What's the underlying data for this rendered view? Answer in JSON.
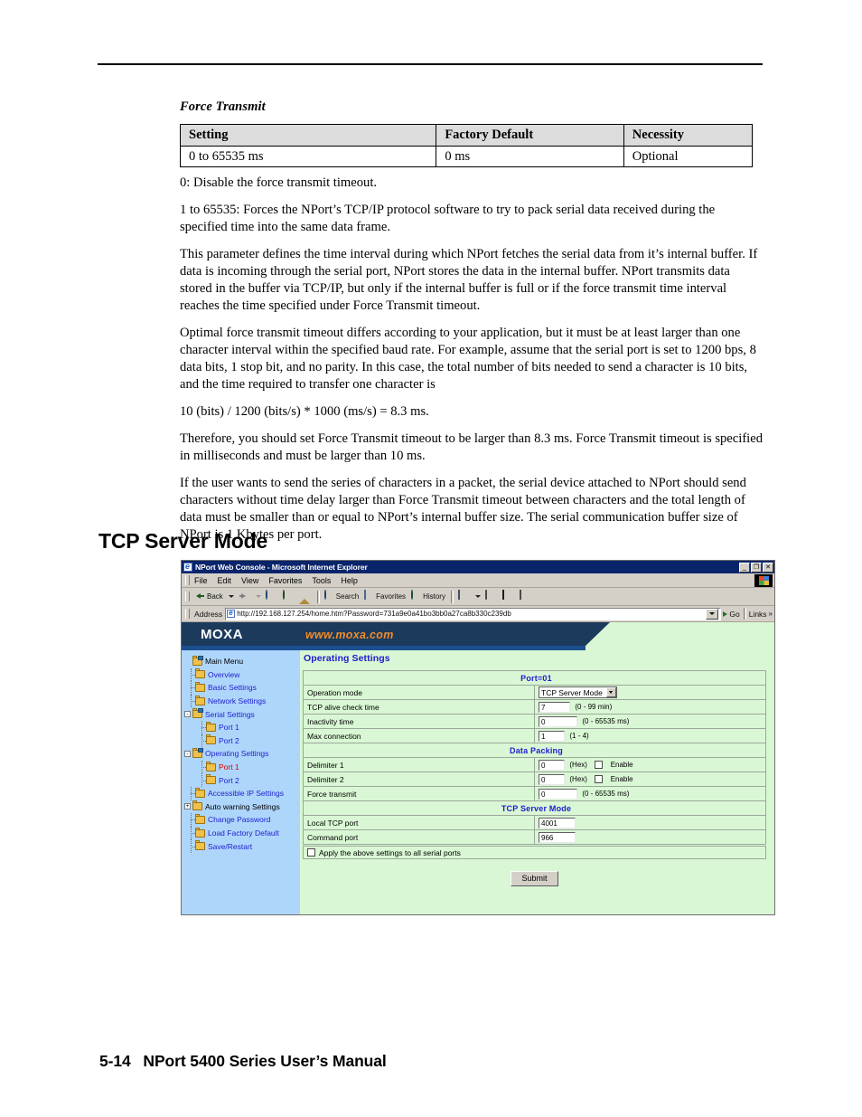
{
  "document": {
    "subhead": "Force Transmit",
    "table": {
      "headers": [
        "Setting",
        "Factory Default",
        "Necessity"
      ],
      "rows": [
        [
          "0 to 65535 ms",
          "0 ms",
          "Optional"
        ]
      ]
    },
    "paragraphs": [
      "0: Disable the force transmit timeout.",
      "1 to 65535: Forces the NPort’s TCP/IP protocol software to try to pack serial data received during the specified time into the same data frame.",
      "This parameter defines the time interval during which NPort fetches the serial data from it’s internal buffer. If data is incoming through the serial port, NPort stores the data in the internal buffer. NPort transmits data stored in the buffer via TCP/IP, but only if the internal buffer is full or if the force transmit time interval reaches the time specified under Force Transmit timeout.",
      "Optimal force transmit timeout differs according to your application, but it must be at least larger than one character interval within the specified baud rate. For example, assume that the serial port is set to 1200 bps, 8 data bits, 1 stop bit, and no parity. In this case, the total number of bits needed to send a character is 10 bits, and the time required to transfer one character is",
      "10 (bits) / 1200 (bits/s) * 1000 (ms/s) = 8.3 ms.",
      "Therefore, you should set Force Transmit timeout to be larger than 8.3 ms. Force Transmit timeout is specified in milliseconds and must be larger than 10 ms.",
      "If the user wants to send the series of characters in a packet, the serial device attached to NPort should send characters without time delay larger than Force Transmit timeout between characters and the total length of data must be smaller than or equal to NPort’s internal buffer size. The serial communication buffer size of NPort is 1 Kbytes per port."
    ],
    "section_heading": "TCP Server Mode",
    "footer": {
      "page_number": "5-14",
      "manual_title": "NPort 5400 Series User’s Manual"
    }
  },
  "browser": {
    "window_title": "NPort Web Console - Microsoft Internet Explorer",
    "window_buttons": {
      "minimize": "_",
      "restore": "❐",
      "close": "✕"
    },
    "menu": [
      "File",
      "Edit",
      "View",
      "Favorites",
      "Tools",
      "Help"
    ],
    "toolbar": [
      {
        "label": "Back",
        "icon": "back-arrow-icon",
        "dropdown": true
      },
      {
        "label": "",
        "icon": "forward-arrow-icon",
        "dropdown": true
      },
      {
        "label": "",
        "icon": "stop-icon",
        "dropdown": false
      },
      {
        "label": "",
        "icon": "refresh-icon",
        "dropdown": false
      },
      {
        "label": "",
        "icon": "home-icon",
        "dropdown": false
      },
      {
        "label": "Search",
        "icon": "search-icon",
        "dropdown": false
      },
      {
        "label": "Favorites",
        "icon": "favorites-icon",
        "dropdown": false
      },
      {
        "label": "History",
        "icon": "history-icon",
        "dropdown": false
      },
      {
        "label": "",
        "icon": "mail-icon",
        "dropdown": true
      },
      {
        "label": "",
        "icon": "print-icon",
        "dropdown": false
      },
      {
        "label": "",
        "icon": "edit-icon",
        "dropdown": false
      },
      {
        "label": "",
        "icon": "discuss-icon",
        "dropdown": false
      }
    ],
    "address": {
      "label": "Address",
      "url": "http://192.168.127.254/home.htm?Password=731a9e0a41bo3bb0a27ca8b330c239db",
      "go_label": "Go",
      "links_label": "Links",
      "links_chevron": "»"
    }
  },
  "webapp": {
    "banner": {
      "logo": "MOXA",
      "url": "www.moxa.com"
    },
    "nav": [
      {
        "label": "Main Menu",
        "level": 0,
        "expander": "",
        "icon": "book-folder-icon",
        "state": "root"
      },
      {
        "label": "Overview",
        "level": 1,
        "expander": "",
        "icon": "folder-icon",
        "state": "link"
      },
      {
        "label": "Basic Settings",
        "level": 1,
        "expander": "",
        "icon": "folder-icon",
        "state": "link"
      },
      {
        "label": "Network Settings",
        "level": 1,
        "expander": "",
        "icon": "folder-icon",
        "state": "link"
      },
      {
        "label": "Serial Settings",
        "level": 1,
        "expander": "-",
        "icon": "book-folder-icon",
        "state": "link"
      },
      {
        "label": "Port 1",
        "level": 2,
        "expander": "",
        "icon": "folder-icon",
        "state": "link"
      },
      {
        "label": "Port 2",
        "level": 2,
        "expander": "",
        "icon": "folder-icon",
        "state": "link"
      },
      {
        "label": "Operating Settings",
        "level": 1,
        "expander": "-",
        "icon": "book-folder-icon",
        "state": "link"
      },
      {
        "label": "Port 1",
        "level": 2,
        "expander": "",
        "icon": "folder-icon",
        "state": "active"
      },
      {
        "label": "Port 2",
        "level": 2,
        "expander": "",
        "icon": "folder-icon",
        "state": "link"
      },
      {
        "label": "Accessible IP Settings",
        "level": 1,
        "expander": "",
        "icon": "folder-icon",
        "state": "link"
      },
      {
        "label": "Auto warning Settings",
        "level": 1,
        "expander": "+",
        "icon": "folder-icon",
        "state": "plain"
      },
      {
        "label": "Change Password",
        "level": 1,
        "expander": "",
        "icon": "folder-icon",
        "state": "link"
      },
      {
        "label": "Load Factory Default",
        "level": 1,
        "expander": "",
        "icon": "folder-icon",
        "state": "link"
      },
      {
        "label": "Save/Restart",
        "level": 1,
        "expander": "",
        "icon": "folder-icon",
        "state": "link"
      }
    ],
    "content_title": "Operating Settings",
    "form": {
      "port_header": "Port=01",
      "operation_mode": {
        "label": "Operation mode",
        "value": "TCP Server Mode"
      },
      "tcp_alive": {
        "label": "TCP alive check time",
        "value": "7",
        "hint": "(0 - 99 min)"
      },
      "inactivity": {
        "label": "Inactivity time",
        "value": "0",
        "hint": "(0 - 65535 ms)"
      },
      "max_connection": {
        "label": "Max connection",
        "value": "1",
        "hint": "(1 - 4)"
      },
      "data_packing_header": "Data Packing",
      "delimiter1": {
        "label": "Delimiter 1",
        "value": "0",
        "hint": "(Hex)",
        "enable_label": "Enable"
      },
      "delimiter2": {
        "label": "Delimiter 2",
        "value": "0",
        "hint": "(Hex)",
        "enable_label": "Enable"
      },
      "force_transmit": {
        "label": "Force transmit",
        "value": "0",
        "hint": "(0 - 65535 ms)"
      },
      "tcp_server_header": "TCP Server Mode",
      "local_tcp_port": {
        "label": "Local TCP port",
        "value": "4001"
      },
      "command_port": {
        "label": "Command port",
        "value": "966"
      },
      "apply_all": "Apply the above settings to all serial ports",
      "submit": "Submit"
    }
  }
}
